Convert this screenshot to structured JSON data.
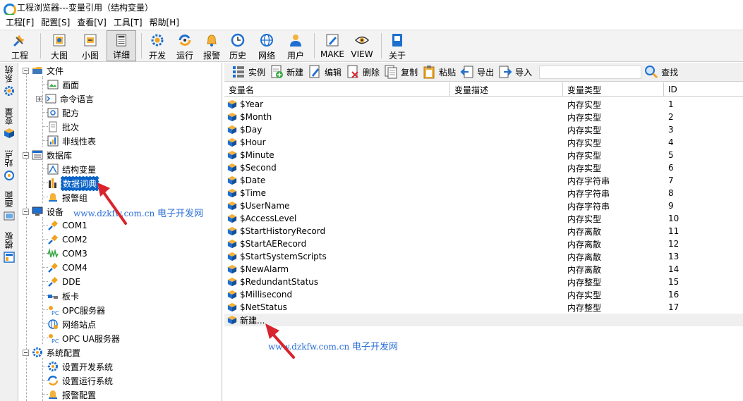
{
  "window": {
    "title": "工程浏览器---变量引用（结构变量）"
  },
  "menu": [
    "工程[F]",
    "配置[S]",
    "查看[V]",
    "工具[T]",
    "帮助[H]"
  ],
  "toolbar": {
    "buttons": [
      {
        "label": "工程",
        "icon": "wrench-icon"
      },
      {
        "label": "大图",
        "icon": "large-view-icon"
      },
      {
        "label": "小图",
        "icon": "small-view-icon"
      },
      {
        "label": "详细",
        "icon": "detail-view-icon"
      },
      {
        "label": "开发",
        "icon": "develop-gear-icon"
      },
      {
        "label": "运行",
        "icon": "run-icon"
      },
      {
        "label": "报警",
        "icon": "bell-icon"
      },
      {
        "label": "历史",
        "icon": "history-clock-icon"
      },
      {
        "label": "网络",
        "icon": "globe-icon"
      },
      {
        "label": "用户",
        "icon": "user-icon"
      },
      {
        "label": "MAKE",
        "icon": "make-pen-icon"
      },
      {
        "label": "VIEW",
        "icon": "view-eye-icon"
      },
      {
        "label": "关于",
        "icon": "about-book-icon"
      }
    ]
  },
  "side_tabs": [
    "系统",
    "变量",
    "站点",
    "画面",
    "模板"
  ],
  "tree": {
    "nodes": [
      {
        "label": "文件",
        "icon": "folder-icon"
      },
      {
        "label": "画面",
        "icon": "screen-icon"
      },
      {
        "label": "命令语言",
        "icon": "command-icon"
      },
      {
        "label": "配方",
        "icon": "recipe-icon"
      },
      {
        "label": "批次",
        "icon": "batch-icon"
      },
      {
        "label": "非线性表",
        "icon": "nonlinear-table-icon"
      },
      {
        "label": "数据库",
        "icon": "database-icon"
      },
      {
        "label": "结构变量",
        "icon": "struct-var-icon"
      },
      {
        "label": "数据词典",
        "icon": "data-dictionary-icon"
      },
      {
        "label": "报警组",
        "icon": "alarm-group-icon"
      },
      {
        "label": "设备",
        "icon": "monitor-icon"
      },
      {
        "label": "COM1",
        "icon": "com-port-icon"
      },
      {
        "label": "COM2",
        "icon": "com-port-icon"
      },
      {
        "label": "COM3",
        "icon": "com-signal-icon"
      },
      {
        "label": "COM4",
        "icon": "com-port-icon"
      },
      {
        "label": "DDE",
        "icon": "dde-icon"
      },
      {
        "label": "板卡",
        "icon": "board-card-icon"
      },
      {
        "label": "OPC服务器",
        "icon": "opc-icon"
      },
      {
        "label": "网络站点",
        "icon": "network-station-icon"
      },
      {
        "label": "OPC UA服务器",
        "icon": "opc-ua-icon"
      },
      {
        "label": "系统配置",
        "icon": "system-config-icon"
      },
      {
        "label": "设置开发系统",
        "icon": "setup-dev-icon"
      },
      {
        "label": "设置运行系统",
        "icon": "setup-run-icon"
      },
      {
        "label": "报警配置",
        "icon": "alarm-config-icon"
      }
    ]
  },
  "right_toolbar": {
    "instance": "实例",
    "new": "新建",
    "edit": "编辑",
    "delete": "删除",
    "copy": "复制",
    "paste": "粘贴",
    "export": "导出",
    "import": "导入",
    "search_value": "",
    "find": "查找"
  },
  "table": {
    "columns": [
      "变量名",
      "变量描述",
      "变量类型",
      "ID"
    ],
    "rows": [
      {
        "name": "$Year",
        "desc": "",
        "type": "内存实型",
        "id": "1"
      },
      {
        "name": "$Month",
        "desc": "",
        "type": "内存实型",
        "id": "2"
      },
      {
        "name": "$Day",
        "desc": "",
        "type": "内存实型",
        "id": "3"
      },
      {
        "name": "$Hour",
        "desc": "",
        "type": "内存实型",
        "id": "4"
      },
      {
        "name": "$Minute",
        "desc": "",
        "type": "内存实型",
        "id": "5"
      },
      {
        "name": "$Second",
        "desc": "",
        "type": "内存实型",
        "id": "6"
      },
      {
        "name": "$Date",
        "desc": "",
        "type": "内存字符串",
        "id": "7"
      },
      {
        "name": "$Time",
        "desc": "",
        "type": "内存字符串",
        "id": "8"
      },
      {
        "name": "$UserName",
        "desc": "",
        "type": "内存字符串",
        "id": "9"
      },
      {
        "name": "$AccessLevel",
        "desc": "",
        "type": "内存实型",
        "id": "10"
      },
      {
        "name": "$StartHistoryRecord",
        "desc": "",
        "type": "内存离散",
        "id": "11"
      },
      {
        "name": "$StartAERecord",
        "desc": "",
        "type": "内存离散",
        "id": "12"
      },
      {
        "name": "$StartSystemScripts",
        "desc": "",
        "type": "内存离散",
        "id": "13"
      },
      {
        "name": "$NewAlarm",
        "desc": "",
        "type": "内存离散",
        "id": "14"
      },
      {
        "name": "$RedundantStatus",
        "desc": "",
        "type": "内存整型",
        "id": "15"
      },
      {
        "name": "$Millisecond",
        "desc": "",
        "type": "内存实型",
        "id": "16"
      },
      {
        "name": "$NetStatus",
        "desc": "",
        "type": "内存整型",
        "id": "17"
      }
    ],
    "new_row_label": "新建..."
  },
  "watermark": {
    "url": "www.dzkfw.com.cn",
    "site": "电子开发网"
  },
  "colors": {
    "selection": "#0a64c8",
    "watermark": "#2b6fd6",
    "arrow": "#d9232d"
  }
}
